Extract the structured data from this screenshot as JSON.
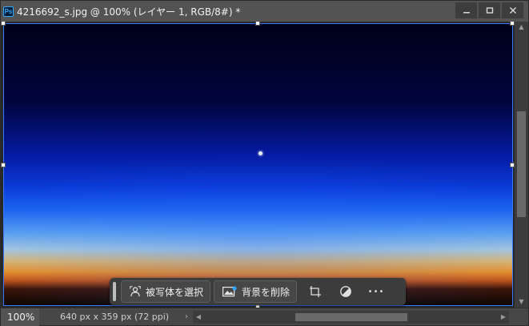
{
  "window": {
    "title": "4216692_s.jpg @ 100% (レイヤー 1, RGB/8#) *",
    "app_icon_text": "Ps",
    "controls": {
      "minimize": "▁",
      "restore": "□",
      "close": "✕"
    }
  },
  "taskbar": {
    "select_subject_label": "被写体を選択",
    "remove_background_label": "背景を削除",
    "more_label": "•••"
  },
  "status": {
    "zoom": "100%",
    "doc_info": "640 px x 359 px (72 ppi)",
    "expand_arrow": "›"
  },
  "colors": {
    "accent": "#3a78ff",
    "ps_blue": "#31a8ff"
  }
}
